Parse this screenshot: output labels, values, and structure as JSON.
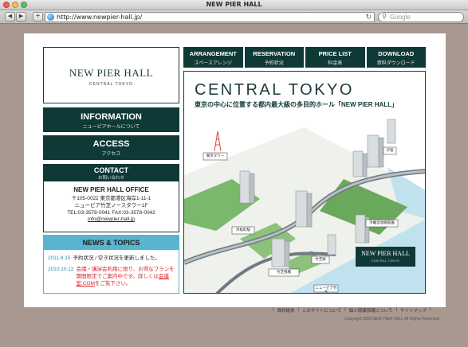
{
  "window": {
    "title": "NEW PIER HALL"
  },
  "browser": {
    "url": "http://www.newpier-hall.jp/",
    "search_placeholder": "Google"
  },
  "logo": {
    "name": "NEW PIER HALL",
    "sub": "CENTRAL TOKYO"
  },
  "side_menu": {
    "information": {
      "en": "INFORMATION",
      "jp": "ニューピアホールについて"
    },
    "access": {
      "en": "ACCESS",
      "jp": "アクセス"
    },
    "contact": {
      "en": "CONTACT",
      "jp": "お問い合わせ"
    }
  },
  "office": {
    "title": "NEW PIER HALL OFFICE",
    "address1": "〒105-0022 東京都港区海岸1-11-1",
    "address2": "ニューピア竹芝ノースタワー1F",
    "phone": "TEL:03-3578-0041 FAX:03-3578-0042",
    "email": "info@newpier-hall.jp"
  },
  "news": {
    "heading": "NEWS & TOPICS",
    "items": [
      {
        "date": "2011.6.15",
        "text": "予約状況 / 空き状況を更新しました。"
      },
      {
        "date": "2010.10.12",
        "text": "会議・講演会利用に限り、お得なプランを期間限定でご案内中です。詳しくは",
        "link": "会議室.COM",
        "tail": "をご覧下さい。"
      }
    ]
  },
  "top_nav": [
    {
      "en": "ARRANGEMENT",
      "jp": "スペースアレンジ"
    },
    {
      "en": "RESERVATION",
      "jp": "予約状況"
    },
    {
      "en": "PRICE LIST",
      "jp": "料金表"
    },
    {
      "en": "DOWNLOAD",
      "jp": "資料ダウンロード"
    }
  ],
  "hero": {
    "title": "CENTRAL TOKYO",
    "subtitle": "東京の中心に位置する都内最大級の多目的ホール「NEW PIER HALL」",
    "labels": {
      "tokyo_tower": "東京タワー",
      "hamamatsucho": "浜松町駅",
      "takeshiba": "竹芝駅",
      "pier": "竹芝桟橋",
      "new_pier": "ニューピア竹芝",
      "garden": "浜離宮恩賜庭園",
      "shiodome": "汐留",
      "badge_name": "NEW PIER HALL",
      "badge_sub": "CENTRAL TOKYO"
    }
  },
  "footer": {
    "links": [
      "資料請求",
      "このサイトについて",
      "個人情報保護について",
      "サイトマップ"
    ],
    "copyright": "Copyright 2009 NEW PIER HALL All Rights Reserved."
  },
  "colors": {
    "accent": "#0f3937",
    "news": "#58b4cf",
    "background": "#a8988f"
  }
}
